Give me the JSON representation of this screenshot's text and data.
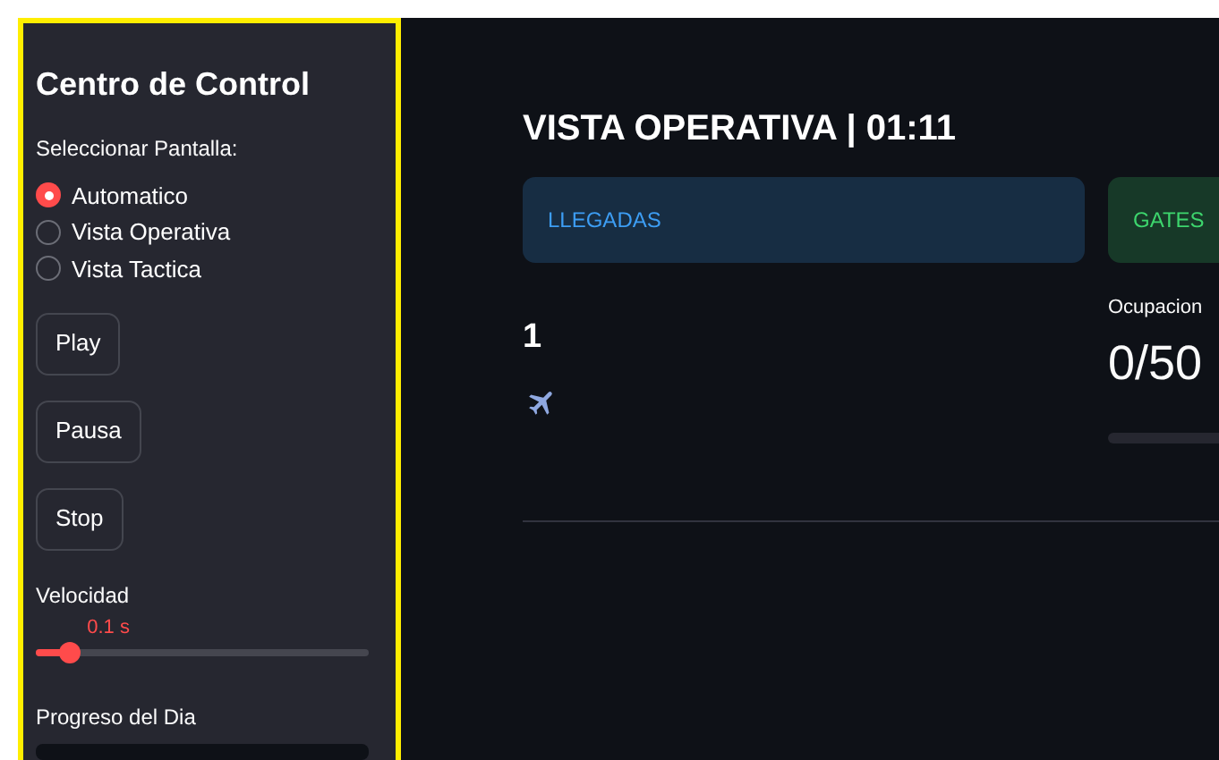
{
  "sidebar": {
    "title": "Centro de Control",
    "radio_label": "Seleccionar Pantalla:",
    "options": [
      {
        "label": "Automatico",
        "selected": true
      },
      {
        "label": "Vista Operativa",
        "selected": false
      },
      {
        "label": "Vista Tactica",
        "selected": false
      }
    ],
    "buttons": [
      "Play",
      "Pausa",
      "Stop"
    ],
    "speed": {
      "label": "Velocidad",
      "reading": "0.1 s",
      "level": 0.1
    },
    "day_progress": {
      "label": "Progreso del Dia",
      "level": 0
    }
  },
  "main": {
    "title": "VISTA OPERATIVA | 01:11",
    "arrivals": {
      "header": "LLEGADAS",
      "count": "1"
    },
    "gates": {
      "header": "GATES",
      "metric_label": "Ocupacion",
      "metric_value": "0/50",
      "level": 0
    }
  }
}
